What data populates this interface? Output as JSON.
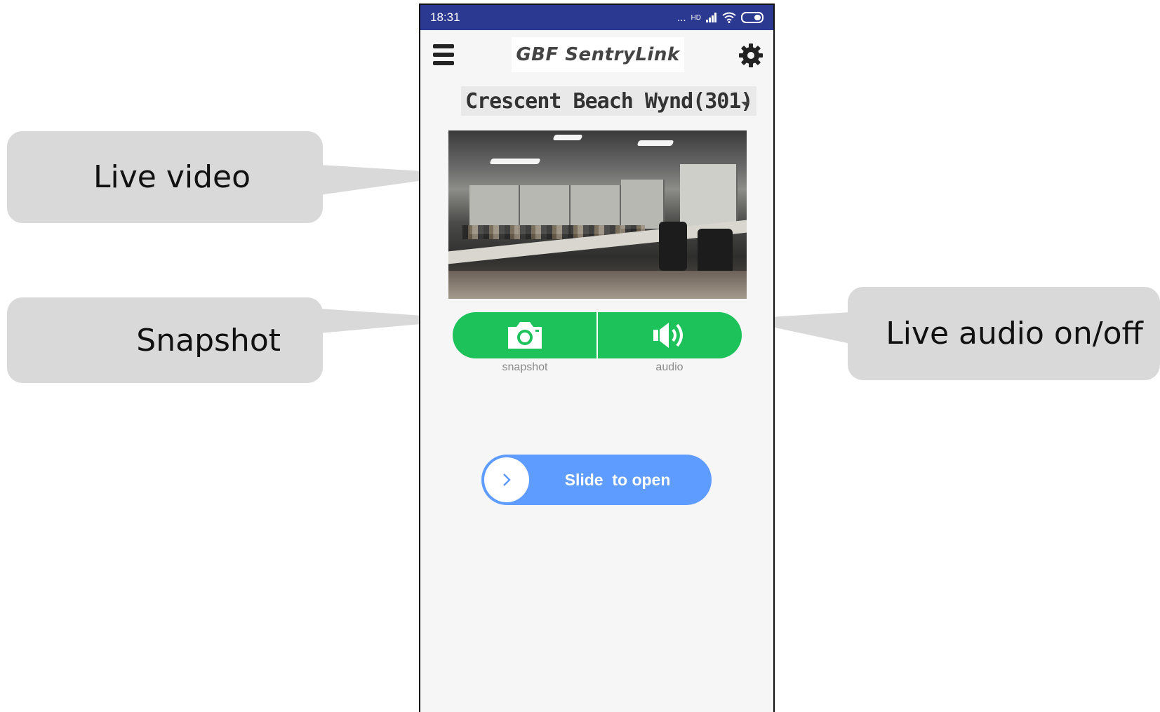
{
  "status_bar": {
    "time": "18:31",
    "signal": "...",
    "network": "HD"
  },
  "app": {
    "logo": "GBF SentryLink"
  },
  "location": {
    "name": "Crescent Beach Wynd(301)"
  },
  "controls": {
    "snapshot_label": "snapshot",
    "audio_label": "audio"
  },
  "slider": {
    "label": "Slide  to open"
  },
  "callouts": {
    "live_video": "Live video",
    "snapshot": "Snapshot",
    "live_audio": "Live audio on/off"
  },
  "colors": {
    "status_bar": "#2b3990",
    "controls_green": "#1ec25a",
    "slider_blue": "#5f9cff",
    "callout_gray": "#d9d9d9"
  }
}
